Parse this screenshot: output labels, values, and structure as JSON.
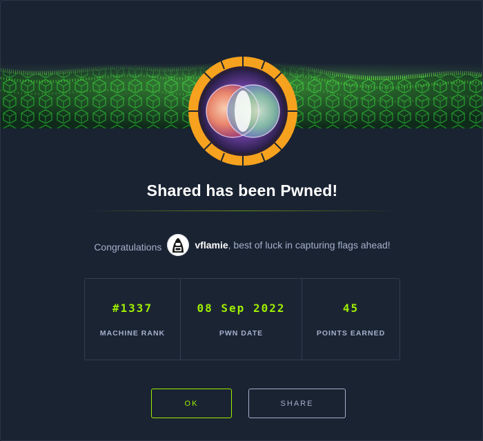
{
  "modal": {
    "title": "Shared has been Pwned!",
    "congrats_lead": "Congratulations",
    "username": "vflamie",
    "congrats_tail": ", best of luck in capturing flags ahead!",
    "accent_color": "#9fef00",
    "badge_ring_color": "#f6a21e"
  },
  "stats": [
    {
      "value": "#1337",
      "label": "MACHINE RANK"
    },
    {
      "value": "08 Sep 2022",
      "label": "PWN DATE"
    },
    {
      "value": "45",
      "label": "POINTS EARNED"
    }
  ],
  "buttons": {
    "ok_label": "OK",
    "share_label": "SHARE"
  }
}
